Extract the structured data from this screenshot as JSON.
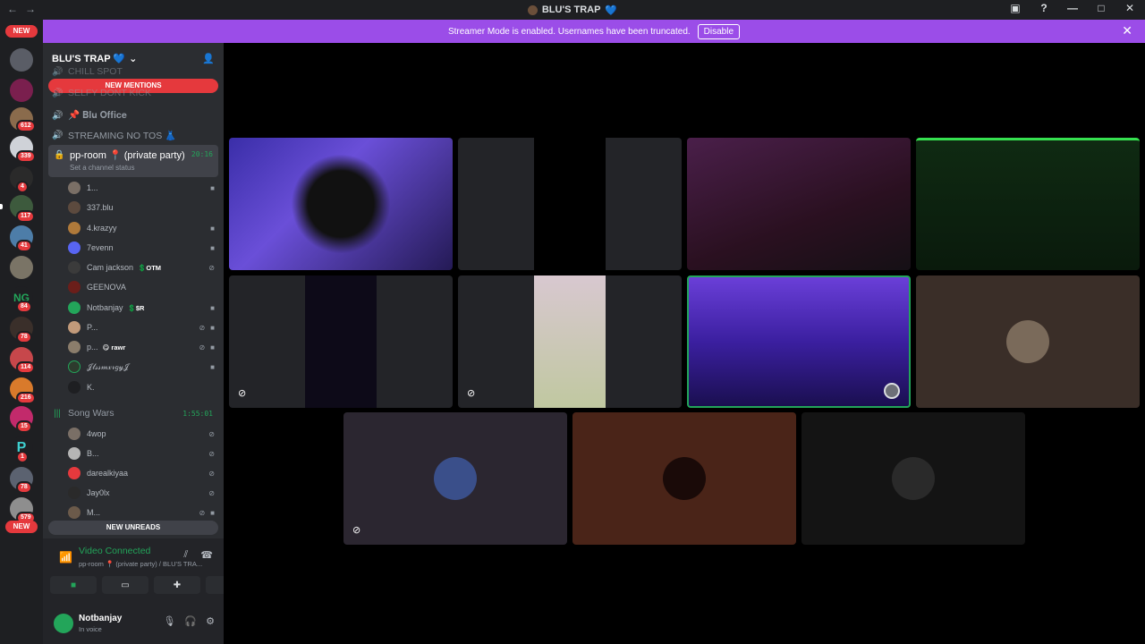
{
  "window": {
    "title": "BLU'S TRAP",
    "title_heart": "💙"
  },
  "banner": {
    "text": "Streamer Mode is enabled. Usernames have been truncated.",
    "disable_label": "Disable"
  },
  "server_rail": {
    "new_top": "NEW",
    "new_bottom": "NEW",
    "badges": [
      "612",
      "339",
      "4",
      "117",
      "41",
      "84",
      "78",
      "114",
      "216",
      "15",
      "1",
      "78",
      "579"
    ]
  },
  "server": {
    "name": "BLU'S TRAP 💙",
    "new_mentions": "NEW MENTIONS",
    "new_unreads": "NEW UNREADS",
    "channels": {
      "chill": "CHILL SPOT",
      "selfy": "SELFY DONT KICK",
      "blu_office": "📌 𝐁𝐥𝐮 𝐎𝐟𝐟𝐢𝐜𝐞",
      "streaming": "STREAMING NO TOS 👗",
      "pp_room": "pp-room 📍 (private party)",
      "pp_room_status": "Set a channel status",
      "pp_room_time": "20:16",
      "song_wars": "Song Wars",
      "song_wars_time": "1:55:01"
    },
    "pp_users": [
      {
        "name": "1...",
        "tag": ""
      },
      {
        "name": "337.blu",
        "tag": ""
      },
      {
        "name": "4.krazyy",
        "tag": ""
      },
      {
        "name": "7evenn",
        "tag": ""
      },
      {
        "name": "Cam jackson",
        "tag": "💲OTM"
      },
      {
        "name": "GEENOVA",
        "tag": ""
      },
      {
        "name": "Notbanjay",
        "tag": "💲$R"
      },
      {
        "name": "P...",
        "tag": ""
      },
      {
        "name": "p...",
        "tag": "😋 rawr"
      },
      {
        "name": "𝒥𝓁𝓈𝓈𝓂𝓍𝓇𝑔𝓎𝒥",
        "tag": ""
      },
      {
        "name": "K.",
        "tag": ""
      }
    ],
    "song_users": [
      {
        "name": "4wop"
      },
      {
        "name": "B..."
      },
      {
        "name": "darealkiyaa"
      },
      {
        "name": "Jay0lx"
      },
      {
        "name": "M..."
      }
    ]
  },
  "voice_panel": {
    "status": "Video Connected",
    "sub": "pp-room 📍 (private party) / BLU'S TRA..."
  },
  "user": {
    "name": "Notbanjay",
    "status": "In voice"
  },
  "colors": {
    "banner": "#9b4de8",
    "connected": "#23a55a",
    "danger": "#e5393d"
  }
}
